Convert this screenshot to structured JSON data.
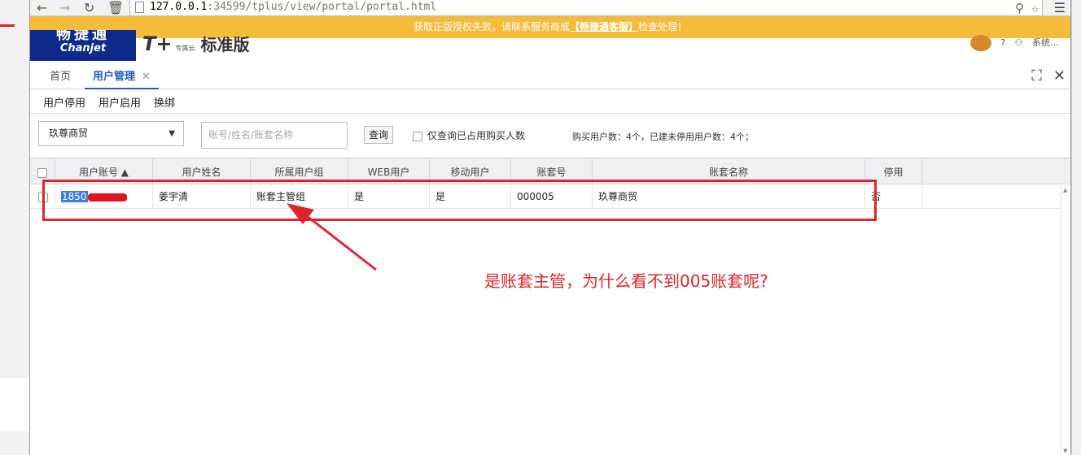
{
  "browser": {
    "back_icon": "back-arrow-icon",
    "forward_icon": "forward-arrow-icon",
    "url_host": "127.0.0.1",
    "url_rest": ":34599/tplus/view/portal/portal.html"
  },
  "notice": {
    "text_before": "获取正版授权失败，请联系服务商或",
    "link": "【畅捷通客服】",
    "text_after": "检查处理！"
  },
  "header": {
    "logo_cn": "畅捷通",
    "logo_en": "Chanjet",
    "brand_tplus": "T+",
    "brand_sub": "专属云",
    "brand_name": "标准版",
    "system_text": "系统…"
  },
  "tabs": [
    {
      "label": "首页"
    },
    {
      "label": "用户管理"
    }
  ],
  "toolbar": {
    "disable_user": "用户停用",
    "enable_user": "用户启用",
    "rebind": "换绑"
  },
  "filter": {
    "account_set": "玖尊商贸",
    "search_placeholder": "账号/姓名/账套名称",
    "query_label": "查询",
    "only_bought_label": "仅查询已占用购买人数",
    "stats": "购买用户数：4个，已建未停用用户数：4个；"
  },
  "grid": {
    "columns": [
      "用户账号 ▲",
      "用户姓名",
      "所属用户组",
      "WEB用户",
      "移动用户",
      "账套号",
      "账套名称",
      "停用"
    ],
    "rows": [
      {
        "account": "1850",
        "name": "姜宇清",
        "group": "账套主管组",
        "web": "是",
        "mobile": "是",
        "set_no": "000005",
        "set_name": "玖尊商贸",
        "disabled": "否"
      }
    ]
  },
  "annotation": {
    "text": "是账套主管，为什么看不到005账套呢?"
  },
  "colors": {
    "notice_bg": "#f5bc3c",
    "tab_active": "#1d5fbf",
    "annotation": "#e0242c",
    "logo_bg": "#0f2a8c"
  }
}
